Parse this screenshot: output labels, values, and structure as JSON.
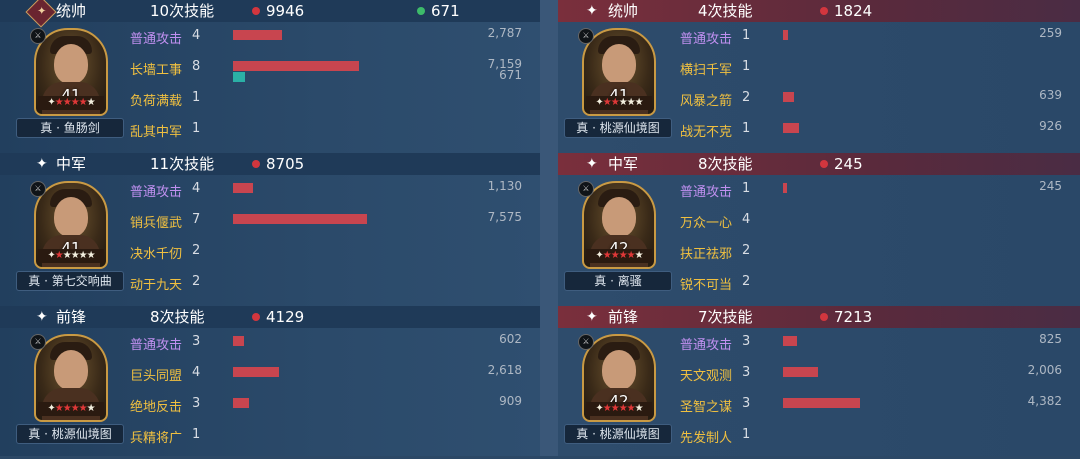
{
  "teams": [
    {
      "side": "left",
      "sections": [
        {
          "role": "统帅",
          "role_icon": "commander-badge-icon",
          "skill_count": "10次技能",
          "damage": "9946",
          "heal": "671",
          "level": "41",
          "stars_red": 4,
          "stars_total": 6,
          "weapon": "真 · 鱼肠剑",
          "skills": [
            {
              "name": "普通攻击",
              "count": "4",
              "type": "normal",
              "value": "2,787",
              "ratio": 0.39
            },
            {
              "name": "长墙工事",
              "count": "8",
              "type": "skill",
              "value": "7,159",
              "ratio": 1.0,
              "heal_value": "671",
              "heal_ratio": 0.094
            },
            {
              "name": "负荷满载",
              "count": "1",
              "type": "skill",
              "value": "",
              "ratio": 0
            },
            {
              "name": "乱其中军",
              "count": "1",
              "type": "skill",
              "value": "",
              "ratio": 0
            }
          ]
        },
        {
          "role": "中军",
          "role_icon": "sparkle-icon",
          "skill_count": "11次技能",
          "damage": "8705",
          "level": "41",
          "stars_red": 1,
          "stars_total": 6,
          "weapon": "真 · 第七交响曲",
          "skills": [
            {
              "name": "普通攻击",
              "count": "4",
              "type": "normal",
              "value": "1,130",
              "ratio": 0.158
            },
            {
              "name": "销兵偃武",
              "count": "7",
              "type": "skill",
              "value": "7,575",
              "ratio": 1.06
            },
            {
              "name": "决水千仞",
              "count": "2",
              "type": "skill",
              "value": "",
              "ratio": 0
            },
            {
              "name": "动于九天",
              "count": "2",
              "type": "skill",
              "value": "",
              "ratio": 0
            }
          ]
        },
        {
          "role": "前锋",
          "role_icon": "sparkle-icon",
          "skill_count": "8次技能",
          "damage": "4129",
          "level": "",
          "stars_red": 4,
          "stars_total": 6,
          "weapon": "真 · 桃源仙境图",
          "skills": [
            {
              "name": "普通攻击",
              "count": "3",
              "type": "normal",
              "value": "602",
              "ratio": 0.084
            },
            {
              "name": "巨头同盟",
              "count": "4",
              "type": "skill",
              "value": "2,618",
              "ratio": 0.366
            },
            {
              "name": "绝地反击",
              "count": "3",
              "type": "skill",
              "value": "909",
              "ratio": 0.127
            },
            {
              "name": "兵精将广",
              "count": "1",
              "type": "skill",
              "value": "",
              "ratio": 0
            }
          ]
        }
      ]
    },
    {
      "side": "right",
      "sections": [
        {
          "role": "统帅",
          "role_icon": "sparkle-icon",
          "skill_count": "4次技能",
          "damage": "1824",
          "level": "41",
          "stars_red": 2,
          "stars_total": 6,
          "weapon": "真 · 桃源仙境图",
          "skills": [
            {
              "name": "普通攻击",
              "count": "1",
              "type": "normal",
              "value": "259",
              "ratio": 0.036
            },
            {
              "name": "横扫千军",
              "count": "1",
              "type": "skill",
              "value": "",
              "ratio": 0
            },
            {
              "name": "风暴之箭",
              "count": "2",
              "type": "skill",
              "value": "639",
              "ratio": 0.089
            },
            {
              "name": "战无不克",
              "count": "1",
              "type": "skill",
              "value": "926",
              "ratio": 0.129
            }
          ]
        },
        {
          "role": "中军",
          "role_icon": "sparkle-icon",
          "skill_count": "8次技能",
          "damage": "245",
          "level": "42",
          "stars_red": 4,
          "stars_total": 6,
          "weapon": "真 · 离骚",
          "skills": [
            {
              "name": "普通攻击",
              "count": "1",
              "type": "normal",
              "value": "245",
              "ratio": 0.034
            },
            {
              "name": "万众一心",
              "count": "4",
              "type": "skill",
              "value": "",
              "ratio": 0
            },
            {
              "name": "扶正祛邪",
              "count": "2",
              "type": "skill",
              "value": "",
              "ratio": 0
            },
            {
              "name": "锐不可当",
              "count": "2",
              "type": "skill",
              "value": "",
              "ratio": 0
            }
          ]
        },
        {
          "role": "前锋",
          "role_icon": "sparkle-icon",
          "skill_count": "7次技能",
          "damage": "7213",
          "level": "42",
          "stars_red": 4,
          "stars_total": 6,
          "weapon": "真 · 桃源仙境图",
          "skills": [
            {
              "name": "普通攻击",
              "count": "3",
              "type": "normal",
              "value": "825",
              "ratio": 0.115
            },
            {
              "name": "天文观测",
              "count": "3",
              "type": "skill",
              "value": "2,006",
              "ratio": 0.28
            },
            {
              "name": "圣智之谋",
              "count": "3",
              "type": "skill",
              "value": "4,382",
              "ratio": 0.612
            },
            {
              "name": "先发制人",
              "count": "1",
              "type": "skill",
              "value": "",
              "ratio": 0
            }
          ]
        }
      ]
    }
  ],
  "colors": {
    "damage_bar": "#c8454f",
    "heal_bar": "#2bb0a6",
    "damage_dot": "#d2363e",
    "heal_dot": "#3dbb6a",
    "normal_attack_text": "#c090f0",
    "skill_text": "#f0c040"
  }
}
